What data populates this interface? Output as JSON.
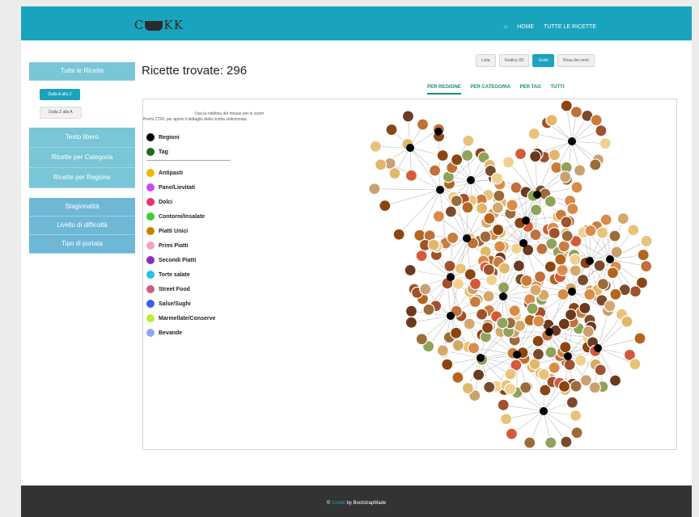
{
  "nav": {
    "logo_left": "C",
    "logo_right": "KK",
    "links": [
      "HOME",
      "TUTTE LE RICETTE"
    ]
  },
  "sidebar": {
    "all_recipes": "Tutte le Ricette",
    "sort_az": "Dalla A alla Z",
    "sort_za": "Dalla Z alla A",
    "group1": [
      "Testo libero",
      "Ricette per Categoria",
      "Ricette per Regione"
    ],
    "group2": [
      "Stagionalità",
      "Livello di difficoltà",
      "Tipo di portata"
    ]
  },
  "main": {
    "results_title": "Ricette trovate: 296",
    "view_buttons": [
      "Lista",
      "Grafico 2D",
      "Grafo",
      "Rosa dei venti"
    ],
    "active_view": "Grafo",
    "tabs": [
      "PER REGIONE",
      "PER CATEGORIA",
      "PER TAG",
      "TUTTI"
    ],
    "active_tab": "PER REGIONE",
    "hint_line1": "Usa la rotellina del mouse per lo zoom",
    "hint_line2": "Premi CTRL per aprire il dettaglio della ricetta selezionata"
  },
  "legend": {
    "node_types": [
      {
        "label": "Regioni",
        "color": "#000000"
      },
      {
        "label": "Tag",
        "color": "#1f6b1f"
      }
    ],
    "categories": [
      {
        "label": "Antipasti",
        "color": "#f5b400"
      },
      {
        "label": "Pane/Lievitati",
        "color": "#c84de8"
      },
      {
        "label": "Dolci",
        "color": "#f0306a"
      },
      {
        "label": "Contorni/Insalate",
        "color": "#3ccf2e"
      },
      {
        "label": "Piatti Unici",
        "color": "#c78200"
      },
      {
        "label": "Primi Piatti",
        "color": "#f5a3b8"
      },
      {
        "label": "Secondi Piatti",
        "color": "#8a2cc8"
      },
      {
        "label": "Torte salate",
        "color": "#26c1f0"
      },
      {
        "label": "Street Food",
        "color": "#d05a8a"
      },
      {
        "label": "Salse/Sughi",
        "color": "#3b5cf0"
      },
      {
        "label": "Marmellate/Conserve",
        "color": "#b9f02a"
      },
      {
        "label": "Bevande",
        "color": "#8ea8f0"
      }
    ]
  },
  "footer": {
    "copyright": "©",
    "site_link": "Cookit",
    "credit": "by BootstrapMade"
  },
  "colors": {
    "brand": "#1aa3bd",
    "sidebar": "#78c6d8",
    "footer": "#333333",
    "tab_text": "#1a8b7a"
  }
}
